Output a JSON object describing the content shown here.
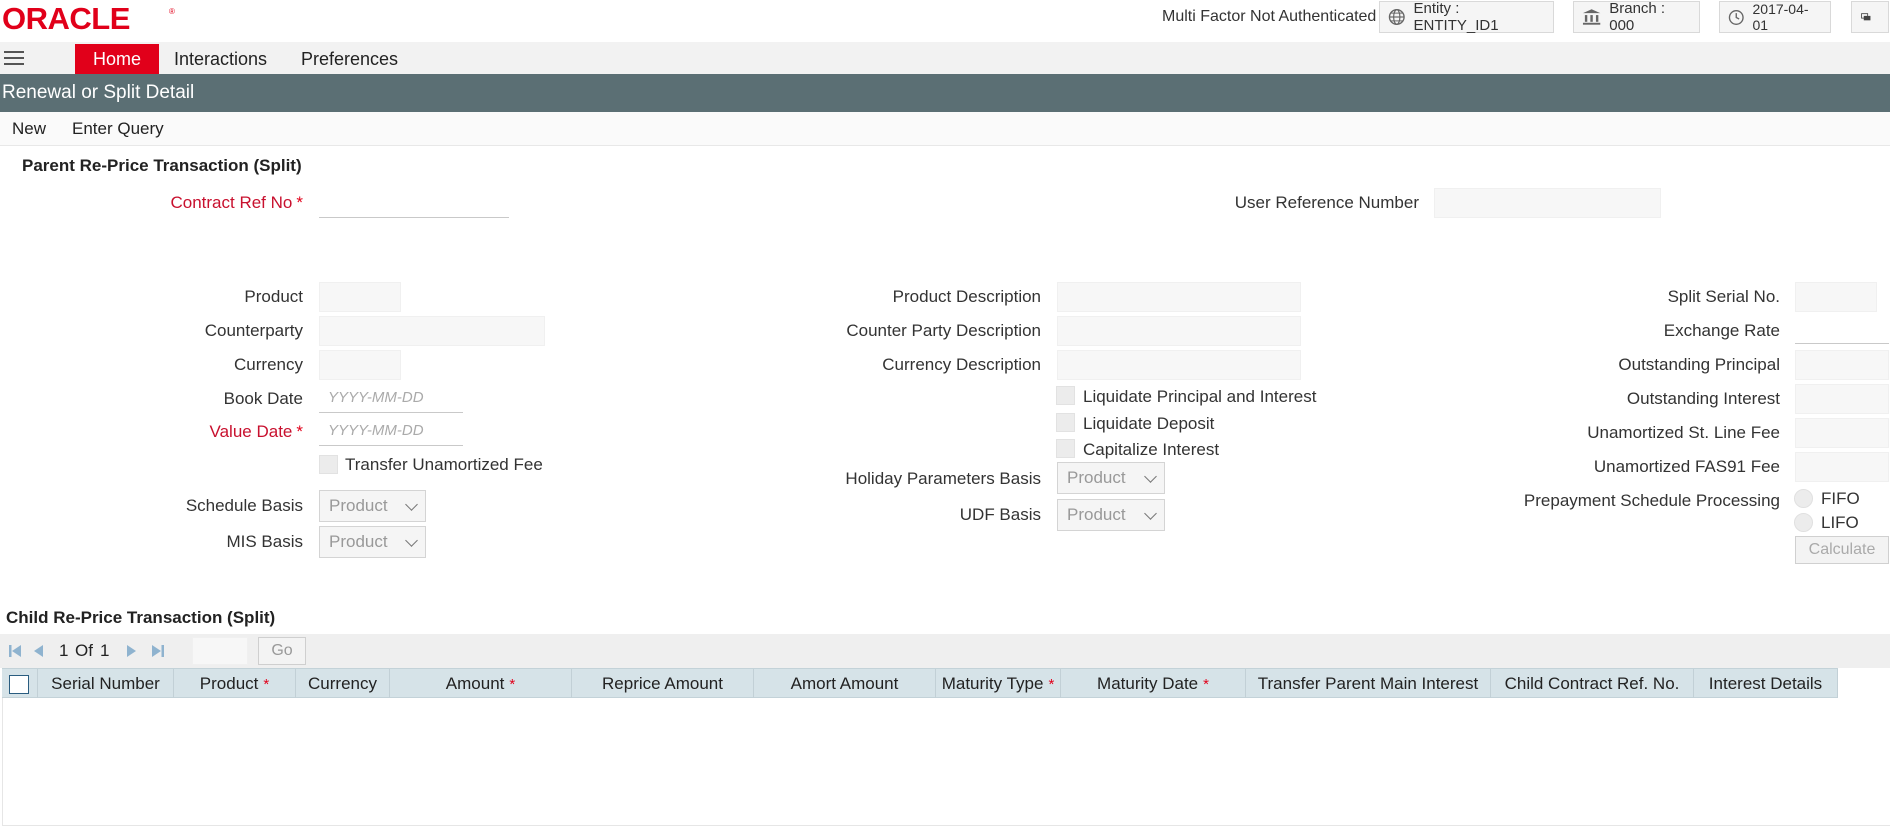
{
  "header": {
    "logo": "ORACLE",
    "mfa_status": "Multi Factor Not Authenticated",
    "entity": "Entity : ENTITY_ID1",
    "branch": "Branch : 000",
    "date": "2017-04-01"
  },
  "nav": {
    "tabs": [
      {
        "label": "Home"
      },
      {
        "label": "Interactions"
      },
      {
        "label": "Preferences"
      }
    ]
  },
  "page_title": "Renewal or Split Detail",
  "toolbar": {
    "new_label": "New",
    "enter_query_label": "Enter Query"
  },
  "parent": {
    "section_title": "Parent Re-Price Transaction (Split)",
    "contract_ref_no": "Contract Ref No",
    "user_reference_number": "User Reference Number",
    "product": "Product",
    "counterparty": "Counterparty",
    "currency": "Currency",
    "book_date": "Book Date",
    "value_date": "Value Date",
    "date_placeholder": "YYYY-MM-DD",
    "transfer_unamortized_fee": "Transfer Unamortized Fee",
    "schedule_basis": "Schedule Basis",
    "mis_basis": "MIS Basis",
    "product_description": "Product Description",
    "counter_party_description": "Counter Party Description",
    "currency_description": "Currency Description",
    "liquidate_principal_interest": "Liquidate Principal and Interest",
    "liquidate_deposit": "Liquidate Deposit",
    "capitalize_interest": "Capitalize Interest",
    "holiday_parameters_basis": "Holiday Parameters Basis",
    "udf_basis": "UDF Basis",
    "select_value": "Product",
    "split_serial_no": "Split Serial No.",
    "exchange_rate": "Exchange Rate",
    "outstanding_principal": "Outstanding Principal",
    "outstanding_interest": "Outstanding Interest",
    "unamortized_st_line_fee": "Unamortized St. Line Fee",
    "unamortized_fas91_fee": "Unamortized FAS91 Fee",
    "prepayment_schedule_processing": "Prepayment Schedule Processing",
    "fifo": "FIFO",
    "lifo": "LIFO",
    "calculate": "Calculate"
  },
  "child": {
    "section_title": "Child Re-Price Transaction (Split)",
    "pager": {
      "current": "1",
      "of_label": "Of",
      "total": "1",
      "go": "Go"
    },
    "columns": [
      {
        "label": "Serial Number",
        "required": false
      },
      {
        "label": "Product",
        "required": true
      },
      {
        "label": "Currency",
        "required": false
      },
      {
        "label": "Amount",
        "required": true
      },
      {
        "label": "Reprice Amount",
        "required": false
      },
      {
        "label": "Amort Amount",
        "required": false
      },
      {
        "label": "Maturity Type",
        "required": true
      },
      {
        "label": "Maturity Date",
        "required": true
      },
      {
        "label": "Transfer Parent Main Interest",
        "required": false
      },
      {
        "label": "Child Contract Ref. No.",
        "required": false
      },
      {
        "label": "Interest Details",
        "required": false
      }
    ],
    "required_marker": "*"
  },
  "colors": {
    "brand_red": "#e1001a",
    "title_bar": "#5b6f74",
    "grid_header": "#d6e3e8"
  }
}
